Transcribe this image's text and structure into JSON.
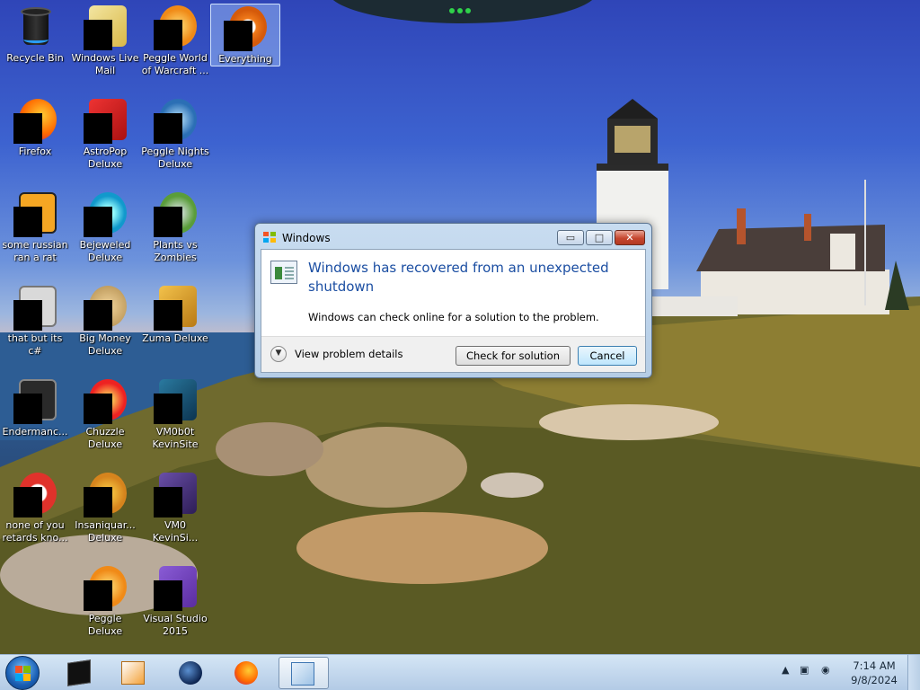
{
  "desktop": {
    "icons": [
      {
        "label": "Recycle Bin",
        "icon": "recycle-bin-icon"
      },
      {
        "label": "Windows Live\nMail",
        "icon": "mail-icon"
      },
      {
        "label": "Peggle World\nof Warcraft ...",
        "icon": "peggle-icon"
      },
      {
        "label": "Everything",
        "icon": "search-icon"
      },
      {
        "label": "Firefox",
        "icon": "firefox-icon"
      },
      {
        "label": "AstroPop\nDeluxe",
        "icon": "astropop-icon"
      },
      {
        "label": "Peggle Nights\nDeluxe",
        "icon": "peggle-nights-icon"
      },
      {
        "label": "some russian\nran a rat",
        "icon": "java-file-icon"
      },
      {
        "label": "Bejeweled\nDeluxe",
        "icon": "bejeweled-icon"
      },
      {
        "label": "Plants vs\nZombies",
        "icon": "plants-icon"
      },
      {
        "label": "that but its c#",
        "icon": "files-icon"
      },
      {
        "label": "Big Money\nDeluxe",
        "icon": "money-bag-icon"
      },
      {
        "label": "Zuma Deluxe",
        "icon": "zuma-icon"
      },
      {
        "label": "Endermanc...",
        "icon": "program-icon"
      },
      {
        "label": "Chuzzle\nDeluxe",
        "icon": "chuzzle-icon"
      },
      {
        "label": "VM0b0t\nKevinSite",
        "icon": "vm-icon"
      },
      {
        "label": "none of you\nretards kno...",
        "icon": "app-icon"
      },
      {
        "label": "Insaniquar...\nDeluxe",
        "icon": "fish-icon"
      },
      {
        "label": "VM0\nKevinSi...",
        "icon": "vm-icon"
      },
      {
        "label": "Peggle Deluxe",
        "icon": "peggle-icon"
      },
      {
        "label": "Visual Studio\n2015",
        "icon": "visual-studio-icon"
      }
    ]
  },
  "dialog": {
    "title": "Windows",
    "heading": "Windows has recovered from an unexpected shutdown",
    "message": "Windows can check online for a solution to the problem.",
    "details_label": "View problem details",
    "check_button": "Check for solution",
    "cancel_button": "Cancel",
    "minimize_glyph": "▭",
    "maximize_glyph": "□",
    "close_glyph": "✕"
  },
  "taskbar": {
    "pinned": [
      "command-prompt-icon",
      "media-player-icon",
      "globe-icon",
      "firefox-icon",
      "problem-report-icon"
    ],
    "tray": {
      "arrow": "▲",
      "network": "▣",
      "volume": "◉"
    },
    "clock": {
      "time": "7:14 AM",
      "date": "9/8/2024"
    }
  },
  "colors": {
    "heading": "#1b4ea2",
    "accent_green": "#2fd24a"
  }
}
